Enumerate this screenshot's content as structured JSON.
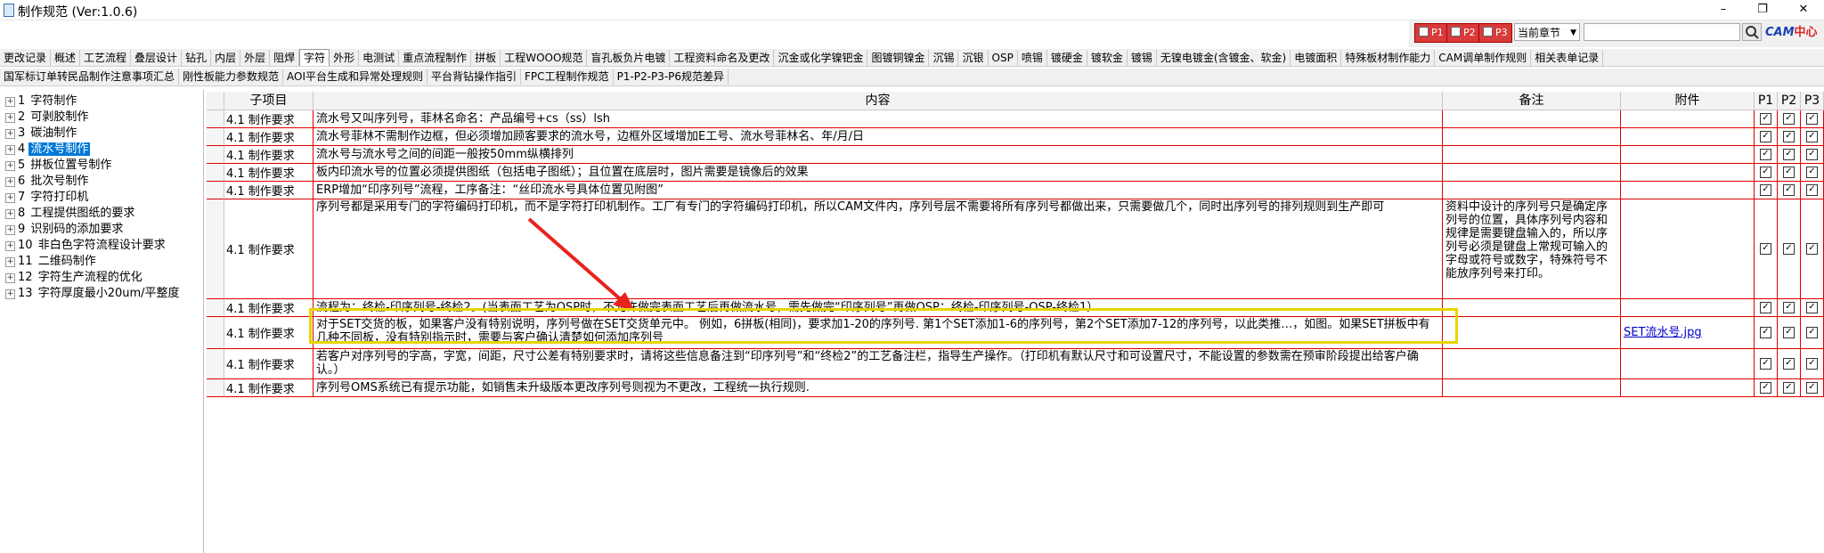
{
  "window": {
    "title": "制作规范 (Ver:1.0.6)",
    "minimize": "–",
    "restore": "❐",
    "close": "✕"
  },
  "toolbar": {
    "filters": [
      {
        "label": "P1"
      },
      {
        "label": "P2"
      },
      {
        "label": "P3"
      }
    ],
    "chapter_select": "当前章节",
    "search_value": "",
    "search_icon": "search-icon",
    "logo": {
      "main": "CAM",
      "accent": "中心"
    }
  },
  "tabs_row1": [
    "更改记录",
    "概述",
    "工艺流程",
    "叠层设计",
    "钻孔",
    "内层",
    "外层",
    "阻焊",
    "字符",
    "外形",
    "电测试",
    "重点流程制作",
    "拼板",
    "工程WOOO规范",
    "盲孔板负片电镀",
    "工程资料命名及更改",
    "沉金或化学镍钯金",
    "图镀铜镍金",
    "沉锡",
    "沉银",
    "OSP",
    "喷锡",
    "镀硬金",
    "镀软金",
    "镀锡",
    "无镍电镀金(含镀金、软金)",
    "电镀面积",
    "特殊板材制作能力",
    "CAM调单制作规则",
    "相关表单记录"
  ],
  "tabs_row2": [
    "国军标订单转民品制作注意事项汇总",
    "刚性板能力参数规范",
    "AOI平台生成和异常处理规则",
    "平台背钻操作指引",
    "FPC工程制作规范",
    "P1-P2-P3-P6规范差异"
  ],
  "active_tab_index": 8,
  "tree": [
    {
      "num": "1",
      "label": "字符制作"
    },
    {
      "num": "2",
      "label": "可剥胶制作"
    },
    {
      "num": "3",
      "label": "碳油制作"
    },
    {
      "num": "4",
      "label": "流水号制作"
    },
    {
      "num": "5",
      "label": "拼板位置号制作"
    },
    {
      "num": "6",
      "label": "批次号制作"
    },
    {
      "num": "7",
      "label": "字符打印机"
    },
    {
      "num": "8",
      "label": "工程提供图纸的要求"
    },
    {
      "num": "9",
      "label": "识别码的添加要求"
    },
    {
      "num": "10",
      "label": "非白色字符流程设计要求"
    },
    {
      "num": "11",
      "label": "二维码制作"
    },
    {
      "num": "12",
      "label": "字符生产流程的优化"
    },
    {
      "num": "13",
      "label": "字符厚度最小20um/平整度"
    }
  ],
  "selected_tree_index": 3,
  "grid": {
    "headers": {
      "sub": "子项目",
      "content": "内容",
      "note": "备注",
      "attach": "附件",
      "p1": "P1",
      "p2": "P2",
      "p3": "P3"
    },
    "rows": [
      {
        "sub": "4.1 制作要求",
        "content": "流水号又叫序列号，菲林名命名：产品编号+cs（ss）lsh",
        "note": "",
        "attach": ""
      },
      {
        "sub": "4.1 制作要求",
        "content": "流水号菲林不需制作边框，但必须增加顾客要求的流水号，边框外区域增加E工号、流水号菲林名、年/月/日",
        "note": "",
        "attach": ""
      },
      {
        "sub": "4.1 制作要求",
        "content": "流水号与流水号之间的间距一般按50mm纵横排列",
        "note": "",
        "attach": ""
      },
      {
        "sub": "4.1 制作要求",
        "content": "板内印流水号的位置必须提供图纸（包括电子图纸）；且位置在底层时，图片需要是镜像后的效果",
        "note": "",
        "attach": ""
      },
      {
        "sub": "4.1 制作要求",
        "content": "ERP增加“印序列号”流程，工序备注：“丝印流水号具体位置见附图”",
        "note": "",
        "attach": ""
      },
      {
        "sub": "4.1 制作要求",
        "content": "序列号都是采用专门的字符编码打印机，而不是字符打印机制作。工厂有专门的字符编码打印机，所以CAM文件内，序列号层不需要将所有序列号都做出来，只需要做几个，同时出序列号的排列规则到生产即可",
        "note": "资料中设计的序列号只是确定序列号的位置，具体序列号内容和规律是需要键盘输入的，所以序列号必须是键盘上常规可输入的字母或符号或数字，特殊符号不能放序列号来打印。",
        "attach": ""
      },
      {
        "sub": "4.1 制作要求",
        "content": "流程为：终检-印序列号-终检2。(当表面工艺为OSP时，不允许做完表面工艺后再做流水号，需先做完“印序列号”再做OSP：终检-印序列号-OSP-终检1）",
        "note": "",
        "attach": ""
      },
      {
        "sub": "4.1 制作要求",
        "content": "对于SET交货的板，如果客户没有特别说明，序列号做在SET交货单元中。 例如，6拼板(相同)，要求加1-20的序列号. 第1个SET添加1-6的序列号，第2个SET添加7-12的序列号，以此类推…，如图。如果SET拼板中有几种不同板，没有特别指示时，需要与客户确认清楚如何添加序列号",
        "note": "",
        "attach": "SET流水号.jpg"
      },
      {
        "sub": "4.1 制作要求",
        "content": "若客户对序列号的字高，字宽，间距，尺寸公差有特别要求时，请将这些信息备注到“印序列号”和“终检2”的工艺备注栏，指导生产操作。（打印机有默认尺寸和可设置尺寸，不能设置的参数需在预审阶段提出给客户确认。）",
        "note": "",
        "attach": ""
      },
      {
        "sub": "4.1 制作要求",
        "content": "序列号OMS系统已有提示功能，如销售未升级版本更改序列号则视为不更改，工程统一执行规则.",
        "note": "",
        "attach": ""
      }
    ],
    "check_mark": "✓"
  },
  "colors": {
    "grid_line": "#dd0000",
    "highlight": "#e8d400",
    "selection": "#0078d7",
    "annotation_arrow": "#e8231e"
  }
}
